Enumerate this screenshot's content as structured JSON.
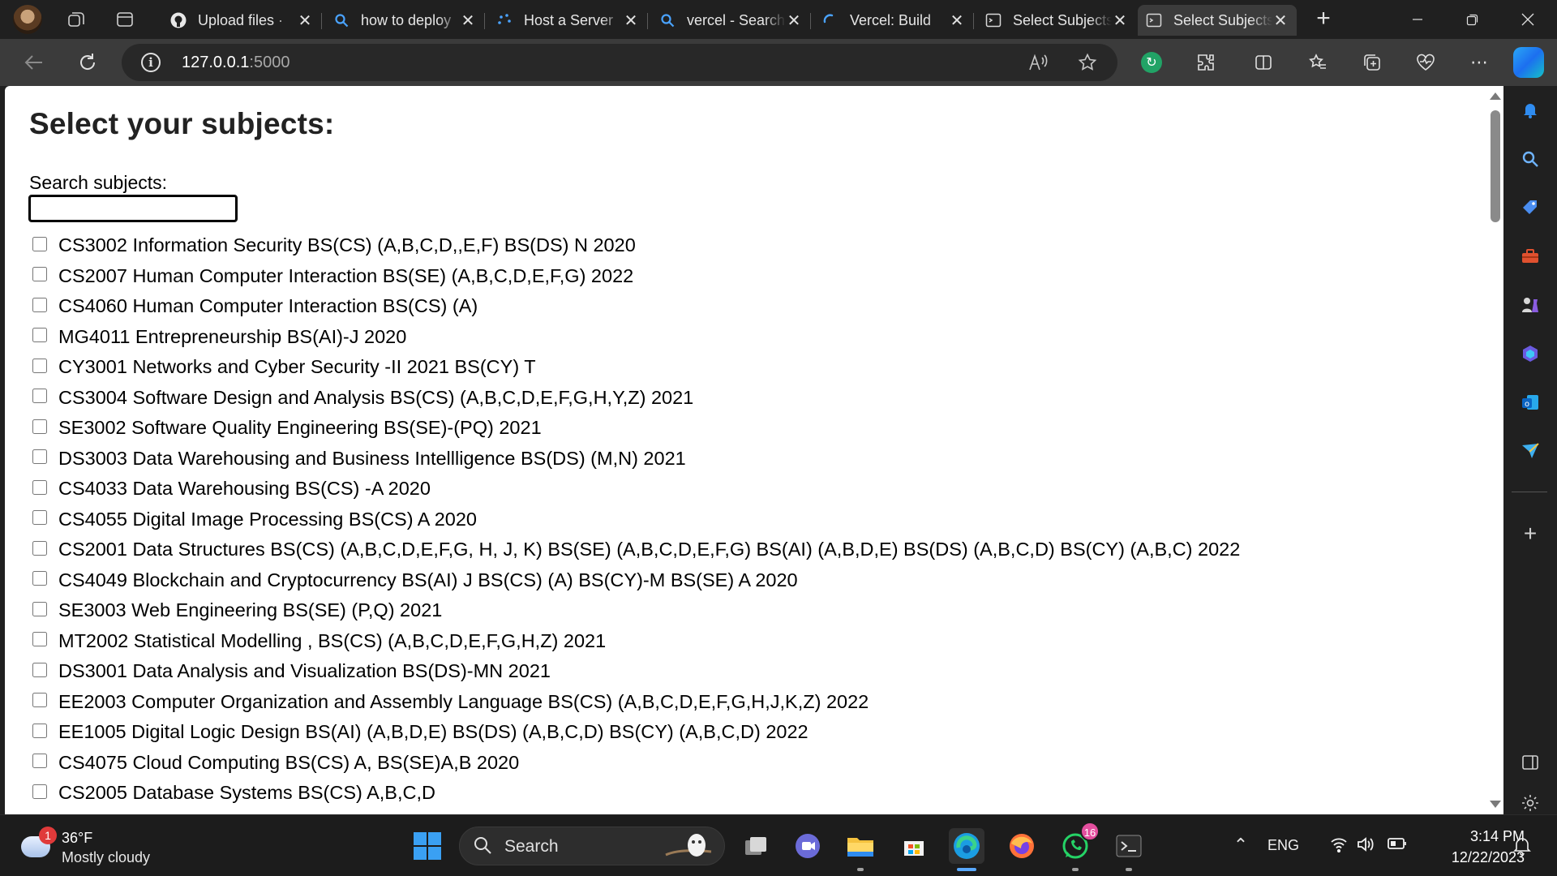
{
  "browser": {
    "tabs": [
      {
        "title": "Upload files · ",
        "favicon": "github-icon",
        "active": false
      },
      {
        "title": "how to deploy",
        "favicon": "search-icon",
        "active": false
      },
      {
        "title": "Host a Server",
        "favicon": "loading-icon",
        "active": false
      },
      {
        "title": "vercel - Search",
        "favicon": "search-icon",
        "active": false
      },
      {
        "title": "Vercel: Build",
        "favicon": "loading-icon",
        "active": false
      },
      {
        "title": "Select Subjects",
        "favicon": "terminal-icon",
        "active": false
      },
      {
        "title": "Select Subjects",
        "favicon": "terminal-icon",
        "active": true
      }
    ],
    "url_host": "127.0.0.1",
    "url_port": ":5000",
    "read_aloud_label": "Aͅ",
    "accent_color": "#3b3b3b"
  },
  "page": {
    "heading": "Select your subjects:",
    "search_label": "Search subjects:",
    "search_value": "",
    "subjects": [
      "CS3002 Information Security BS(CS) (A,B,C,D,,E,F) BS(DS) N 2020",
      "CS2007 Human Computer Interaction BS(SE) (A,B,C,D,E,F,G) 2022",
      "CS4060 Human Computer Interaction BS(CS) (A)",
      "MG4011 Entrepreneurship BS(AI)-J 2020",
      "CY3001 Networks and Cyber Security -II 2021 BS(CY) T",
      "CS3004 Software Design and Analysis BS(CS) (A,B,C,D,E,F,G,H,Y,Z) 2021",
      "SE3002 Software Quality Engineering BS(SE)-(PQ) 2021",
      "DS3003 Data Warehousing and Business Intellligence BS(DS) (M,N) 2021",
      "CS4033 Data Warehousing BS(CS) -A 2020",
      "CS4055 Digital Image Processing BS(CS) A 2020",
      "CS2001 Data Structures BS(CS) (A,B,C,D,E,F,G, H, J, K) BS(SE) (A,B,C,D,E,F,G) BS(AI) (A,B,D,E) BS(DS) (A,B,C,D) BS(CY) (A,B,C) 2022",
      "CS4049 Blockchain and Cryptocurrency BS(AI) J BS(CS) (A) BS(CY)-M BS(SE) A 2020",
      "SE3003 Web Engineering BS(SE) (P,Q) 2021",
      "MT2002 Statistical Modelling , BS(CS) (A,B,C,D,E,F,G,H,Z) 2021",
      "DS3001 Data Analysis and Visualization BS(DS)-MN 2021",
      "EE2003 Computer Organization and Assembly Language BS(CS) (A,B,C,D,E,F,G,H,J,K,Z) 2022",
      "EE1005 Digital Logic Design BS(AI) (A,B,D,E) BS(DS) (A,B,C,D) BS(CY) (A,B,C,D) 2022",
      "CS4075 Cloud Computing BS(CS) A, BS(SE)A,B 2020",
      "CS2005 Database Systems BS(CS) A,B,C,D"
    ]
  },
  "taskbar": {
    "weather_temp": "36°F",
    "weather_condition": "Mostly cloudy",
    "weather_badge": "1",
    "search_label": "Search",
    "whatsapp_badge": "16",
    "language": "ENG",
    "time": "3:14 PM",
    "date": "12/22/2023"
  }
}
